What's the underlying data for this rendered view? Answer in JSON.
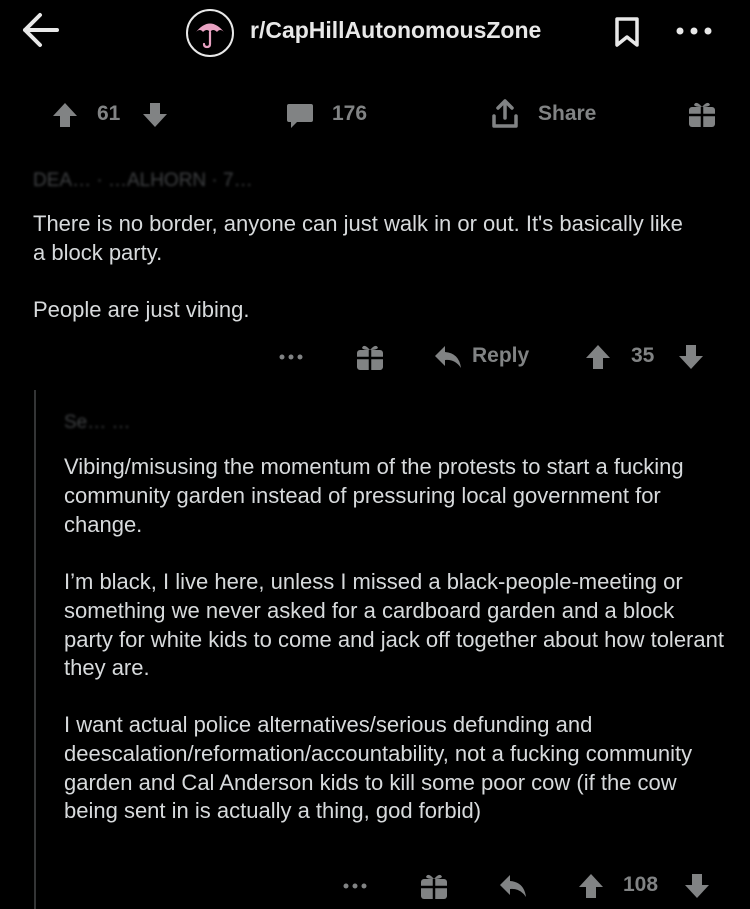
{
  "header": {
    "subreddit": "r/CapHillAutonomousZone",
    "icons": {
      "back": "arrow-left-icon",
      "avatar": "umbrella-icon",
      "bookmark": "bookmark-icon",
      "more": "more-horizontal-icon"
    }
  },
  "post_bar": {
    "score": "61",
    "comment_count": "176",
    "share_label": "Share"
  },
  "comment1": {
    "author": "DEA… · …ALHORN · 7…",
    "paragraphs": [
      "There is no border, anyone can just walk in or out. It's basically like a block party.",
      "People are just vibing."
    ],
    "reply_label": "Reply",
    "score": "35"
  },
  "comment2": {
    "author": "Se… …",
    "paragraphs": [
      "Vibing/misusing the momentum of the protests to start a fucking community garden instead of pressuring local government for change.",
      "I’m black, I live here, unless I missed a black-people-meeting or something we never asked for a cardboard garden and a block party for white kids to come and jack off together about how tolerant they are.",
      "I want actual police alternatives/serious defunding and deescalation/reformation/accountability, not a fucking community garden and Cal Anderson kids to kill some poor cow (if the cow being sent in is actually a thing, god forbid)"
    ],
    "score": "108"
  },
  "colors": {
    "background": "#000000",
    "text": "#d7dadc",
    "muted": "#818384",
    "avatar_accent": "#e8a2c2"
  }
}
